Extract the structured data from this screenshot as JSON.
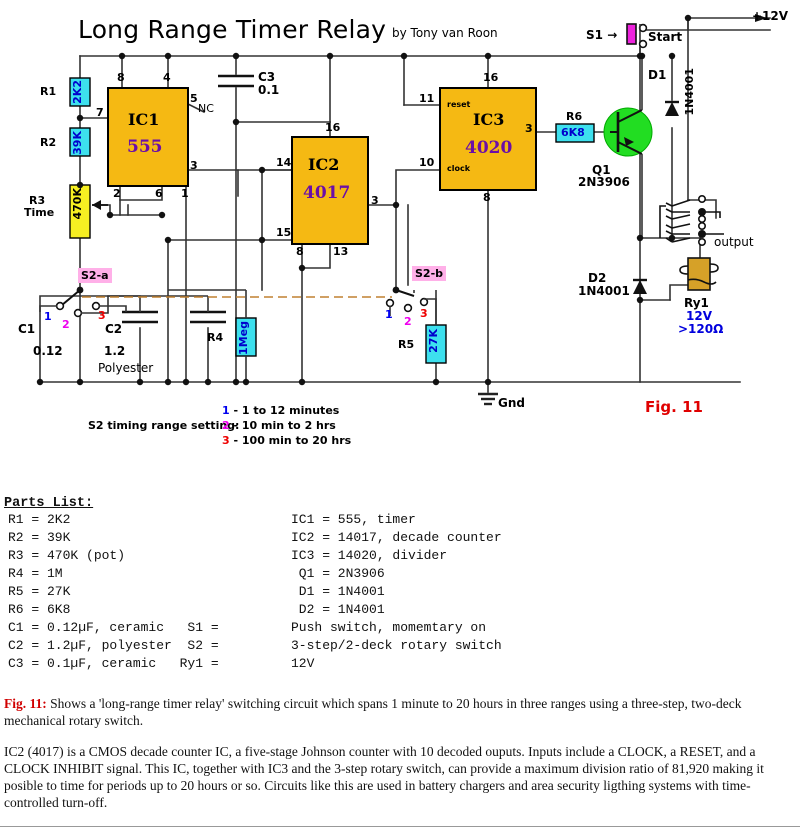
{
  "schematic": {
    "title": "Long Range Timer Relay",
    "byline": "by Tony van Roon",
    "fig_label": "Fig. 11",
    "power_rail": "+12V",
    "ground_label": "Gnd",
    "output_label": "output",
    "switch_s1": {
      "ref": "S1",
      "arrow": "→",
      "label": "Start"
    },
    "ics": [
      {
        "ref": "IC1",
        "part": "555",
        "pins": [
          "8",
          "4",
          "7",
          "5",
          "3",
          "2",
          "6",
          "1"
        ],
        "pin_note": "NC"
      },
      {
        "ref": "IC2",
        "part": "4017",
        "pins": [
          "16",
          "14",
          "15",
          "3",
          "8",
          "13"
        ]
      },
      {
        "ref": "IC3",
        "part": "4020",
        "pins": [
          "16",
          "11",
          "10",
          "3",
          "8"
        ],
        "pin_labels": [
          "reset",
          "clock"
        ]
      }
    ],
    "resistors": [
      {
        "ref": "R1",
        "value": "2K2",
        "color": "#3de0ee"
      },
      {
        "ref": "R2",
        "value": "39K",
        "color": "#3de0ee"
      },
      {
        "ref": "R3",
        "value": "470K",
        "sub": "Time",
        "color": "#f6ef22"
      },
      {
        "ref": "R4",
        "value": "1Meg",
        "color": "#3de0ee"
      },
      {
        "ref": "R5",
        "value": "27K",
        "color": "#3de0ee"
      },
      {
        "ref": "R6",
        "value": "6K8",
        "color": "#3de0ee"
      }
    ],
    "capacitors": [
      {
        "ref": "C1",
        "value": "0.12"
      },
      {
        "ref": "C2",
        "value": "1.2",
        "note": "Polyester"
      },
      {
        "ref": "C3",
        "value": "0.1"
      }
    ],
    "transistor": {
      "ref": "Q1",
      "part": "2N3906",
      "color": "#22dd22"
    },
    "diodes": [
      {
        "ref": "D1",
        "part": "1N4001"
      },
      {
        "ref": "D2",
        "part": "1N4001"
      }
    ],
    "relay": {
      "ref": "Ry1",
      "voltage": "12V",
      "coil": ">120Ω",
      "color": "#d6a128"
    },
    "rotary_switch": {
      "deck_a": "S2-a",
      "deck_b": "S2-b",
      "positions": [
        "1",
        "2",
        "3"
      ],
      "position_colors": [
        "#0000ee",
        "#ee00ee",
        "#ee0000"
      ]
    },
    "timing_note": {
      "label": "S2 timing range setting:",
      "ranges": [
        {
          "num": "1",
          "text": "- 1 to 12 minutes",
          "color": "#0000ee"
        },
        {
          "num": "2",
          "text": "- 10 min to 2 hrs",
          "color": "#ee00ee"
        },
        {
          "num": "3",
          "text": "- 100 min to 20 hrs",
          "color": "#ee0000"
        }
      ]
    }
  },
  "parts_list": {
    "heading": "Parts List:",
    "rows": [
      {
        "left": "R1 = 2K2",
        "right": "IC1 = 555, timer"
      },
      {
        "left": "R2 = 39K",
        "right": "IC2 = 14017, decade counter"
      },
      {
        "left": "R3 = 470K (pot)",
        "right": "IC3 = 14020, divider"
      },
      {
        "left": "R4 = 1M",
        "right": " Q1 = 2N3906"
      },
      {
        "left": "R5 = 27K",
        "right": " D1 = 1N4001"
      },
      {
        "left": "R6 = 6K8",
        "right": " D2 = 1N4001"
      },
      {
        "left": "C1 = 0.12µF, ceramic   S1 = ",
        "right": "Push switch, momemtary on"
      },
      {
        "left": "C2 = 1.2µF, polyester  S2 = ",
        "right": "3-step/2-deck rotary switch"
      },
      {
        "left": "C3 = 0.1µF, ceramic   Ry1 = ",
        "right": "12V"
      }
    ]
  },
  "caption": {
    "fig_prefix": "Fig. 11:",
    "paragraph1": " Shows a 'long-range timer relay' switching circuit which spans 1 minute to 20 hours in three ranges using a three-step, two-deck mechanical rotary switch.",
    "paragraph2": "IC2 (4017) is a CMOS decade counter IC, a five-stage Johnson counter with 10 decoded ouputs. Inputs include a CLOCK, a RESET, and a CLOCK INHIBIT signal. This IC, together with IC3 and the 3-step rotary switch, can provide a maximum division ratio of 81,920 making it posible to time for periods up to 20 hours or so. Circuits like this are used in battery chargers and area security ligthing systems with time-controlled turn-off."
  }
}
